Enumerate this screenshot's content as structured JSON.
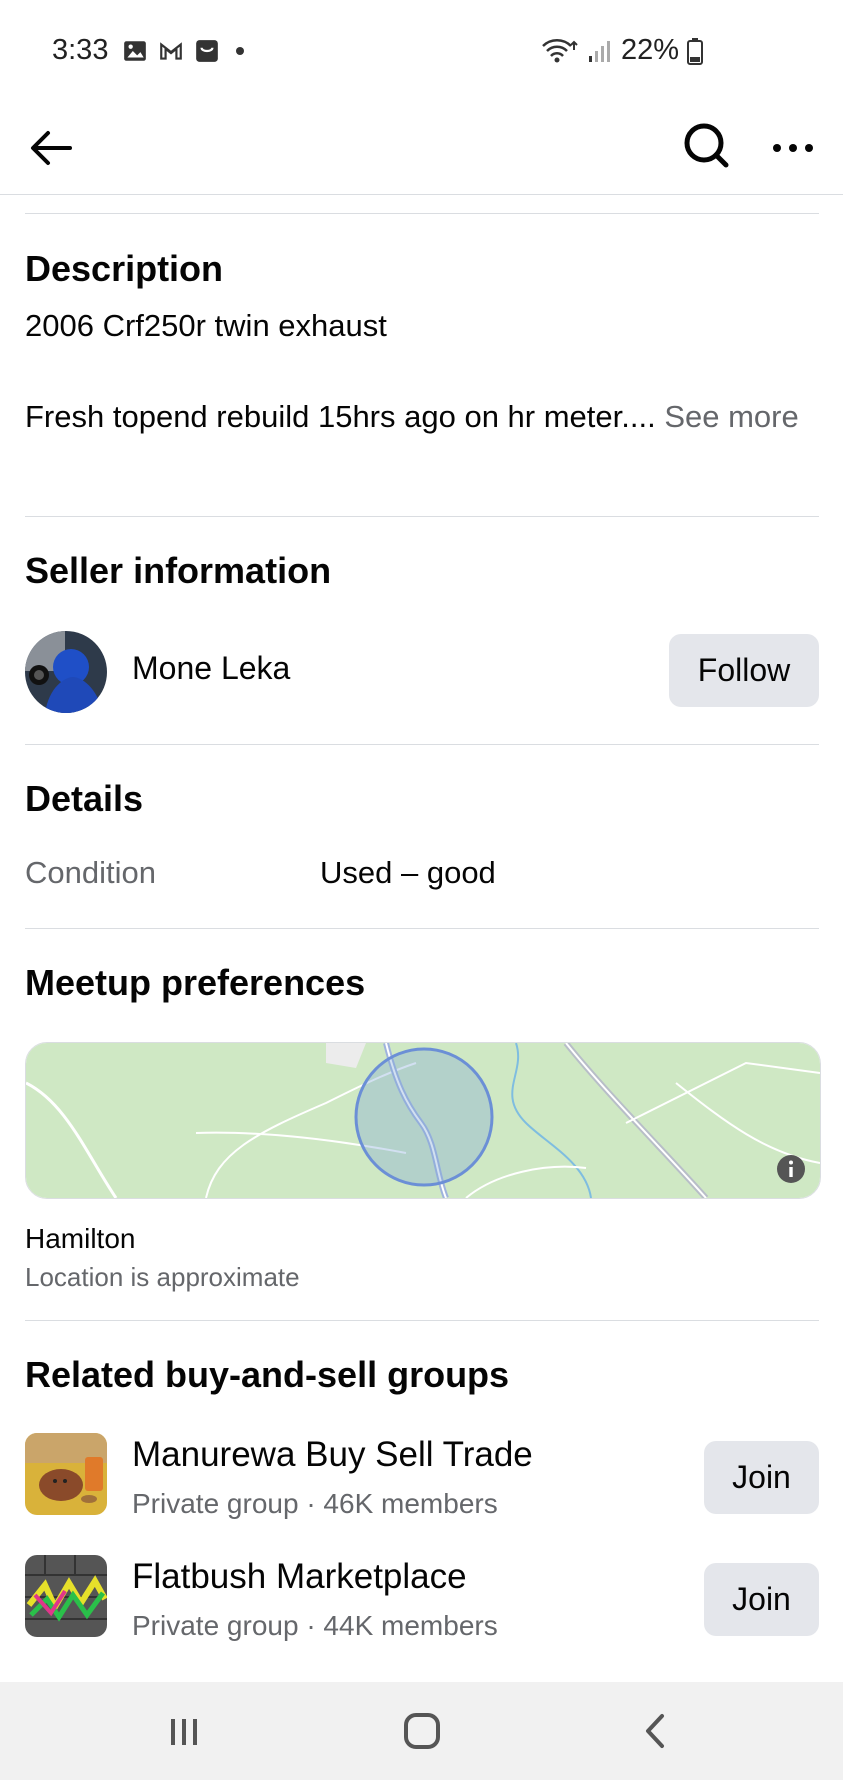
{
  "status_bar": {
    "time": "3:33",
    "battery": "22%"
  },
  "app_bar": {
    "back_icon": "arrow-left-icon",
    "search_icon": "search-icon",
    "more_icon": "more-icon"
  },
  "description": {
    "title": "Description",
    "line1": "2006 Crf250r twin exhaust",
    "line2": "Fresh topend rebuild 15hrs ago on hr meter.... ",
    "see_more": "See more"
  },
  "seller": {
    "title": "Seller information",
    "name": "Mone Leka",
    "follow_label": "Follow"
  },
  "details": {
    "title": "Details",
    "condition_label": "Condition",
    "condition_value": "Used – good"
  },
  "meetup": {
    "title": "Meetup preferences",
    "location": "Hamilton",
    "note": "Location is approximate"
  },
  "groups": {
    "title": "Related buy-and-sell groups",
    "items": [
      {
        "name": "Manurewa Buy Sell Trade",
        "meta": "Private group · 46K members",
        "join_label": "Join"
      },
      {
        "name": "Flatbush Marketplace",
        "meta": "Private group · 44K members",
        "join_label": "Join"
      }
    ]
  },
  "colors": {
    "button_bg": "#e4e6eb",
    "muted_text": "#65676b",
    "map_green": "#cfe8c4",
    "radius_blue": "#6b8fd6"
  }
}
